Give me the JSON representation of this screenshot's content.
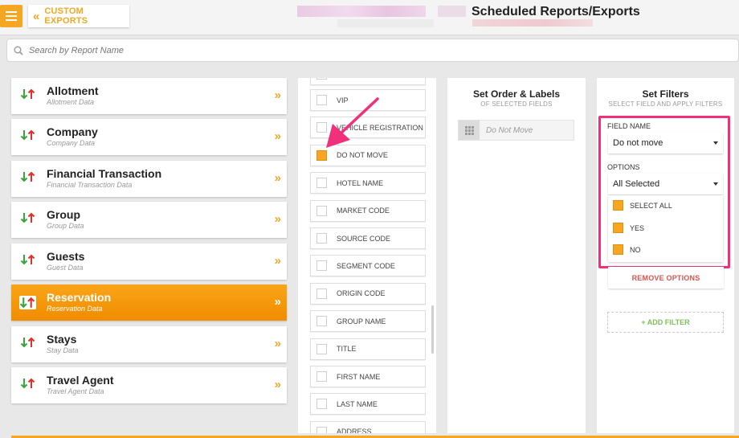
{
  "header": {
    "back_label": "CUSTOM EXPORTS",
    "title": "Scheduled Reports/Exports"
  },
  "search": {
    "placeholder": "Search by Report Name"
  },
  "categories": [
    {
      "name": "Allotment",
      "sub": "Allotment Data"
    },
    {
      "name": "Company",
      "sub": "Company Data"
    },
    {
      "name": "Financial Transaction",
      "sub": "Financial Transaction Data"
    },
    {
      "name": "Group",
      "sub": "Group Data"
    },
    {
      "name": "Guests",
      "sub": "Guest Data"
    },
    {
      "name": "Reservation",
      "sub": "Reservation Data",
      "active": true
    },
    {
      "name": "Stays",
      "sub": "Stay Data"
    },
    {
      "name": "Travel Agent",
      "sub": "Travel Agent Data"
    }
  ],
  "fields": [
    {
      "label": "VIP",
      "checked": false
    },
    {
      "label": "VEHICLE REGISTRATION N...",
      "checked": false
    },
    {
      "label": "DO NOT MOVE",
      "checked": true
    },
    {
      "label": "HOTEL NAME",
      "checked": false
    },
    {
      "label": "MARKET CODE",
      "checked": false
    },
    {
      "label": "SOURCE CODE",
      "checked": false
    },
    {
      "label": "SEGMENT CODE",
      "checked": false
    },
    {
      "label": "ORIGIN CODE",
      "checked": false
    },
    {
      "label": "GROUP NAME",
      "checked": false
    },
    {
      "label": "TITLE",
      "checked": false
    },
    {
      "label": "FIRST NAME",
      "checked": false
    },
    {
      "label": "LAST NAME",
      "checked": false
    },
    {
      "label": "ADDRESS",
      "checked": false
    }
  ],
  "order": {
    "title": "Set Order & Labels",
    "subtitle": "OF SELECTED FIELDS",
    "item": "Do Not Move"
  },
  "filters": {
    "title": "Set Filters",
    "subtitle": "SELECT FIELD AND APPLY FILTERS",
    "field_name_label": "FIELD NAME",
    "field_name_value": "Do not move",
    "options_label": "OPTIONS",
    "options_value": "All Selected",
    "option_items": [
      "SELECT ALL",
      "YES",
      "NO"
    ],
    "remove_label": "REMOVE OPTIONS",
    "add_label": "+ ADD FILTER"
  },
  "colors": {
    "accent": "#f5a623",
    "highlight": "#f0307a",
    "remove": "#d9534f",
    "add": "#7dbf5a"
  }
}
